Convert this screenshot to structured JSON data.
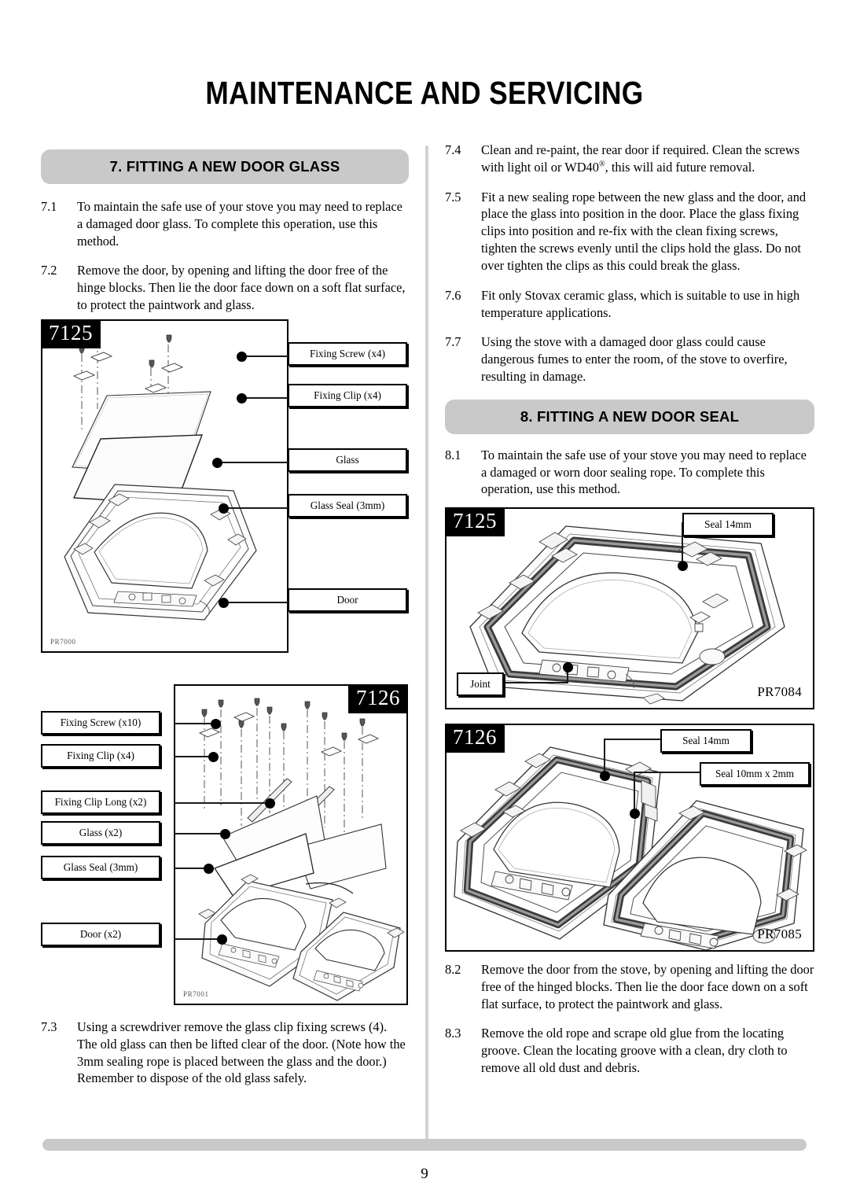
{
  "page": {
    "title": "MAINTENANCE AND SERVICING",
    "number": "9"
  },
  "left_column": {
    "section_heading": "7. FITTING A NEW DOOR GLASS",
    "paragraphs": [
      {
        "num": "7.1",
        "text": "To maintain the safe use of your stove you may need to replace a damaged door glass. To complete this operation, use this method."
      },
      {
        "num": "7.2",
        "text": "Remove the door, by opening and lifting the door free of the hinge blocks. Then lie the door face down on a soft flat surface, to protect the paintwork and glass."
      }
    ],
    "paragraph_bottom": {
      "num": "7.3",
      "text": "Using a screwdriver remove the glass clip fixing screws (4). The old glass can then be lifted clear of the door. (Note how the 3mm sealing rope is placed between the glass and the door.) Remember to dispose of the old glass safely."
    },
    "figure_7125": {
      "badge": "7125",
      "part_code": "PR7000",
      "callouts": [
        "Fixing Screw (x4)",
        "Fixing Clip (x4)",
        "Glass",
        "Glass Seal (3mm)",
        "Door"
      ]
    },
    "figure_7126": {
      "badge": "7126",
      "part_code": "PR7001",
      "callouts": [
        "Fixing Screw (x10)",
        "Fixing Clip (x4)",
        "Fixing Clip Long (x2)",
        "Glass (x2)",
        "Glass Seal (3mm)",
        "Door (x2)"
      ]
    }
  },
  "right_column": {
    "paragraphs_top": [
      {
        "num": "7.4",
        "text_a": "Clean and re-paint, the rear door if required. Clean the screws with light oil or WD40",
        "reg": "®",
        "text_b": ", this will aid future removal."
      },
      {
        "num": "7.5",
        "text": "Fit a new sealing rope between the new glass and the door, and place the glass into position in the door. Place the glass fixing clips into position and re-fix with the clean fixing screws, tighten the screws evenly until the clips hold the glass. Do not over tighten the clips as this could break the glass."
      },
      {
        "num": "7.6",
        "text": "Fit only Stovax ceramic glass, which is suitable to use in high temperature applications."
      },
      {
        "num": "7.7",
        "text": "Using the stove with a damaged door glass could cause dangerous fumes to enter the room, of the stove to overfire, resulting in damage."
      }
    ],
    "section_heading": "8. FITTING A NEW DOOR SEAL",
    "paragraph_81": {
      "num": "8.1",
      "text": "To maintain the safe use of your stove you may need to replace a damaged or worn door sealing rope. To complete this operation, use this method."
    },
    "figure_7084": {
      "badge": "7125",
      "pr_code": "PR7084",
      "callouts": [
        "Seal 14mm",
        "Joint"
      ]
    },
    "figure_7085": {
      "badge": "7126",
      "pr_code": "PR7085",
      "callouts": [
        "Seal 14mm",
        "Seal 10mm x 2mm"
      ]
    },
    "paragraphs_bottom": [
      {
        "num": "8.2",
        "text": "Remove the door from the stove, by opening and lifting the door free of the hinged blocks. Then lie the door face down on a soft flat surface, to protect the paintwork and glass."
      },
      {
        "num": "8.3",
        "text": "Remove the old rope and scrape old glue from the locating groove. Clean the locating groove with a clean, dry cloth to remove all old dust and debris."
      }
    ]
  }
}
